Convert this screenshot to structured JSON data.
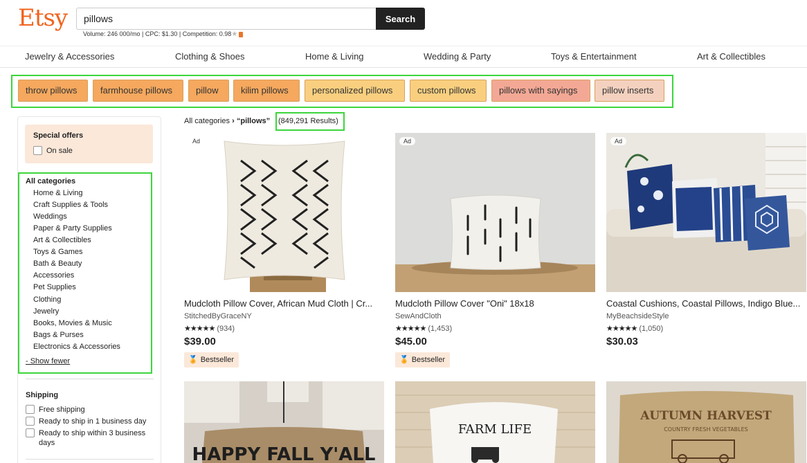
{
  "header": {
    "logo": "Etsy",
    "search_value": "pillows",
    "search_button": "Search",
    "metrics": "Volume: 246 000/mo | CPC: $1.30 | Competition: 0.98"
  },
  "category_nav": [
    "Jewelry & Accessories",
    "Clothing & Shoes",
    "Home & Living",
    "Wedding & Party",
    "Toys & Entertainment",
    "Art & Collectibles"
  ],
  "related_searches": [
    {
      "label": "throw pillows",
      "color": "#f5a85e"
    },
    {
      "label": "farmhouse pillows",
      "color": "#f5a85e"
    },
    {
      "label": "pillow",
      "color": "#f5a85e"
    },
    {
      "label": "kilim pillows",
      "color": "#f5a85e"
    },
    {
      "label": "personalized pillows",
      "color": "#f9cf7f"
    },
    {
      "label": "custom pillows",
      "color": "#f9cf7f"
    },
    {
      "label": "pillows with sayings",
      "color": "#f3a895"
    },
    {
      "label": "pillow inserts",
      "color": "#f4d1bf"
    }
  ],
  "sidebar": {
    "offers_title": "Special offers",
    "on_sale": "On sale",
    "categories_title": "All categories",
    "categories": [
      "Home & Living",
      "Craft Supplies & Tools",
      "Weddings",
      "Paper & Party Supplies",
      "Art & Collectibles",
      "Toys & Games",
      "Bath & Beauty",
      "Accessories",
      "Pet Supplies",
      "Clothing",
      "Jewelry",
      "Books, Movies & Music",
      "Bags & Purses",
      "Electronics & Accessories"
    ],
    "show_fewer": "- Show fewer",
    "shipping_title": "Shipping",
    "shipping_options": [
      "Free shipping",
      "Ready to ship in 1 business day",
      "Ready to ship within 3 business days"
    ]
  },
  "breadcrumb": {
    "root": "All categories",
    "separator": "›",
    "query": "“pillows”",
    "results": "(849,291 Results)"
  },
  "listings": [
    {
      "ad": "Ad",
      "title": "Mudcloth Pillow Cover, African Mud Cloth | Cr...",
      "shop": "StitchedByGraceNY",
      "stars": "★★★★★",
      "reviews": "(934)",
      "price": "$39.00",
      "badge": "Bestseller"
    },
    {
      "ad": "Ad",
      "title": "Mudcloth Pillow Cover \"Oni\" 18x18",
      "shop": "SewAndCloth",
      "stars": "★★★★★",
      "reviews": "(1,453)",
      "price": "$45.00",
      "badge": "Bestseller"
    },
    {
      "ad": "Ad",
      "title": "Coastal Cushions, Coastal Pillows, Indigo Blue...",
      "shop": "MyBeachsideStyle",
      "stars": "★★★★★",
      "reviews": "(1,050)",
      "price": "$30.03",
      "badge": ""
    }
  ],
  "bottom_images": {
    "fall_text": "HAPPY FALL Y'ALL",
    "farm_text": "FARM LIFE",
    "autumn_text": "AUTUMN HARVEST",
    "autumn_sub": "COUNTRY FRESH VEGETABLES"
  }
}
